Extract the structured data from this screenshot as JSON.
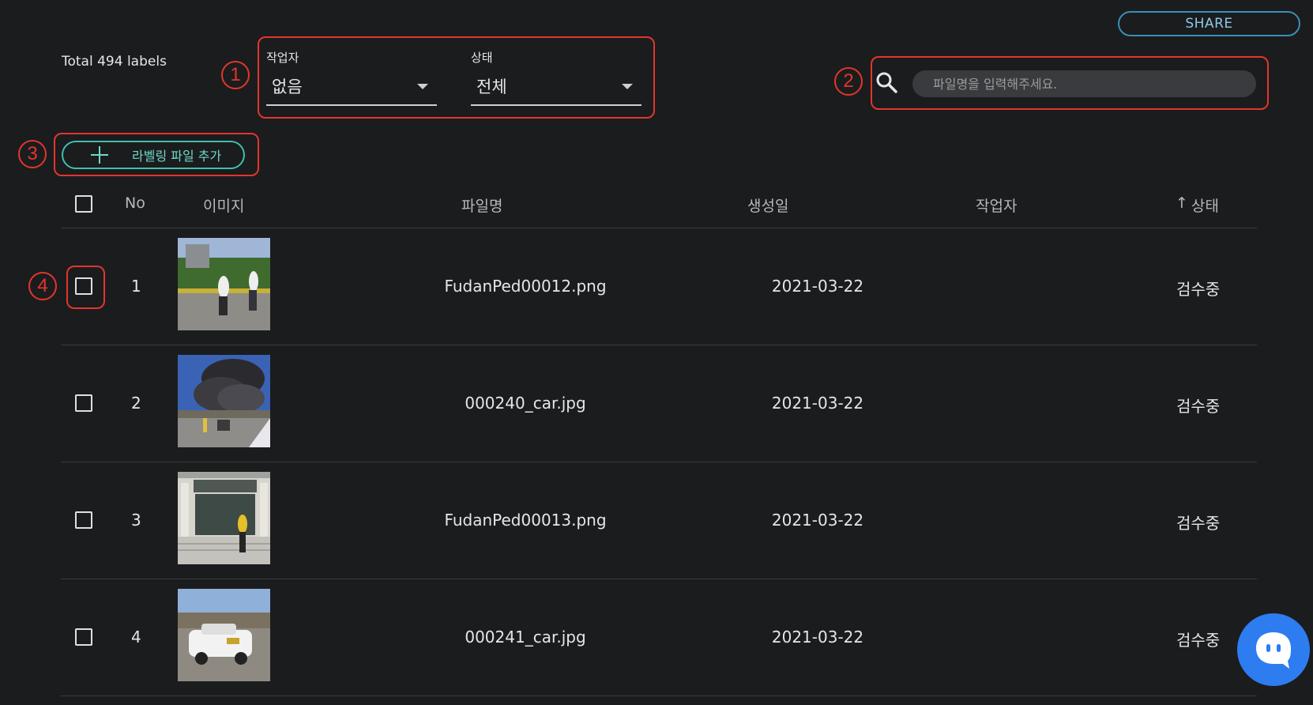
{
  "share_label": "SHARE",
  "total_label": "Total 494 labels",
  "filters": {
    "worker": {
      "label": "작업자",
      "value": "없음"
    },
    "status": {
      "label": "상태",
      "value": "전체"
    }
  },
  "search": {
    "placeholder": "파일명을 입력해주세요."
  },
  "add_button_label": "라벨링 파일 추가",
  "annotations": [
    "1",
    "2",
    "3",
    "4"
  ],
  "table": {
    "headers": {
      "no": "No",
      "image": "이미지",
      "filename": "파일명",
      "created": "생성일",
      "worker": "작업자",
      "status": "상태"
    },
    "sort_indicator": "↑",
    "rows": [
      {
        "no": "1",
        "filename": "FudanPed00012.png",
        "created": "2021-03-22",
        "worker": "",
        "status": "검수중",
        "thumb": "pedestrians-street"
      },
      {
        "no": "2",
        "filename": "000240_car.jpg",
        "created": "2021-03-22",
        "worker": "",
        "status": "검수중",
        "thumb": "smoke-road"
      },
      {
        "no": "3",
        "filename": "FudanPed00013.png",
        "created": "2021-03-22",
        "worker": "",
        "status": "검수중",
        "thumb": "building-pedestrian"
      },
      {
        "no": "4",
        "filename": "000241_car.jpg",
        "created": "2021-03-22",
        "worker": "",
        "status": "검수중",
        "thumb": "police-car"
      }
    ]
  },
  "colors": {
    "background": "#1b1c1e",
    "accent_teal": "#3fbfae",
    "share_blue": "#3a8fb7",
    "annotation_red": "#e2362b",
    "chat_blue": "#2d7cf0"
  }
}
